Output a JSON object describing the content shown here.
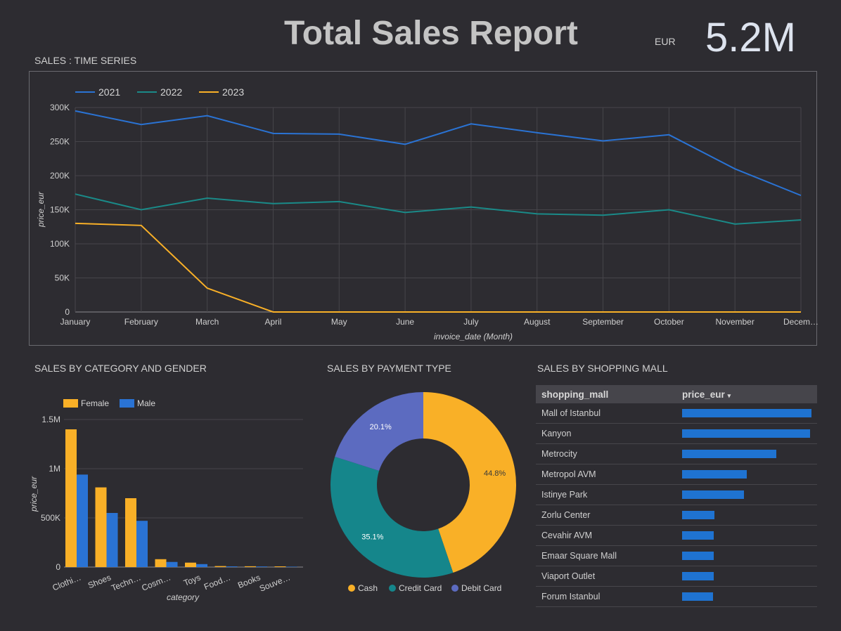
{
  "header": {
    "title": "Total Sales Report",
    "currency": "EUR",
    "total": "5.2M"
  },
  "colors": {
    "y2021": "#2a73d4",
    "y2022": "#1a8a88",
    "y2023": "#f9b027",
    "female": "#f9b027",
    "male": "#2a73d4",
    "cash": "#f9b027",
    "credit": "#15868b",
    "debit": "#5c6bc0"
  },
  "sections": {
    "time_series": "SALES : TIME SERIES",
    "category_gender": "SALES BY CATEGORY AND GENDER",
    "payment": "SALES BY PAYMENT TYPE",
    "mall": "SALES BY SHOPPING MALL"
  },
  "chart_data": [
    {
      "type": "line",
      "x": [
        "January",
        "February",
        "March",
        "April",
        "May",
        "June",
        "July",
        "August",
        "September",
        "October",
        "November",
        "Decem…"
      ],
      "xlabel": "invoice_date (Month)",
      "ylabel": "price_eur",
      "ylim": [
        0,
        300000
      ],
      "yticks": [
        "0",
        "50K",
        "100K",
        "150K",
        "200K",
        "250K",
        "300K"
      ],
      "legend": "top-left",
      "series": [
        {
          "name": "2021",
          "color": "#2a73d4",
          "values": [
            295000,
            275000,
            288000,
            262000,
            261000,
            246000,
            276000,
            263000,
            251000,
            260000,
            210000,
            171000
          ]
        },
        {
          "name": "2022",
          "color": "#1a8a88",
          "values": [
            173000,
            150000,
            167000,
            159000,
            162000,
            146000,
            154000,
            144000,
            142000,
            150000,
            129000,
            135000
          ]
        },
        {
          "name": "2023",
          "color": "#f9b027",
          "values": [
            130000,
            127000,
            35000,
            0,
            0,
            0,
            0,
            0,
            0,
            0,
            0,
            0
          ]
        }
      ]
    },
    {
      "type": "bar",
      "categories": [
        "Clothi…",
        "Shoes",
        "Techn…",
        "Cosm…",
        "Toys",
        "Food…",
        "Books",
        "Souve…"
      ],
      "xlabel": "category",
      "ylabel": "price_eur",
      "ylim": [
        0,
        1500000
      ],
      "yticks": [
        "0",
        "500K",
        "1M",
        "1.5M"
      ],
      "legend": "top-left",
      "series": [
        {
          "name": "Female",
          "color": "#f9b027",
          "values": [
            1400000,
            810000,
            700000,
            80000,
            45000,
            10000,
            8000,
            7000
          ]
        },
        {
          "name": "Male",
          "color": "#2a73d4",
          "values": [
            940000,
            550000,
            470000,
            52000,
            30000,
            7000,
            6000,
            4000
          ]
        }
      ]
    },
    {
      "type": "pie",
      "donut": true,
      "legend": "bottom",
      "slices": [
        {
          "label": "Cash",
          "value": 44.8,
          "display": "44.8%",
          "color": "#f9b027"
        },
        {
          "label": "Credit Card",
          "value": 35.1,
          "display": "35.1%",
          "color": "#15868b"
        },
        {
          "label": "Debit Card",
          "value": 20.1,
          "display": "20.1%",
          "color": "#5c6bc0"
        }
      ]
    },
    {
      "type": "table",
      "columns": [
        "shopping_mall",
        "price_eur"
      ],
      "sort_indicator": "▾",
      "rows": [
        {
          "mall": "Mall of Istanbul",
          "value": 1.0
        },
        {
          "mall": "Kanyon",
          "value": 0.988
        },
        {
          "mall": "Metrocity",
          "value": 0.73
        },
        {
          "mall": "Metropol AVM",
          "value": 0.5
        },
        {
          "mall": "Istinye Park",
          "value": 0.48
        },
        {
          "mall": "Zorlu Center",
          "value": 0.25
        },
        {
          "mall": "Cevahir AVM",
          "value": 0.245
        },
        {
          "mall": "Emaar Square Mall",
          "value": 0.245
        },
        {
          "mall": "Viaport Outlet",
          "value": 0.245
        },
        {
          "mall": "Forum Istanbul",
          "value": 0.24
        }
      ]
    }
  ]
}
